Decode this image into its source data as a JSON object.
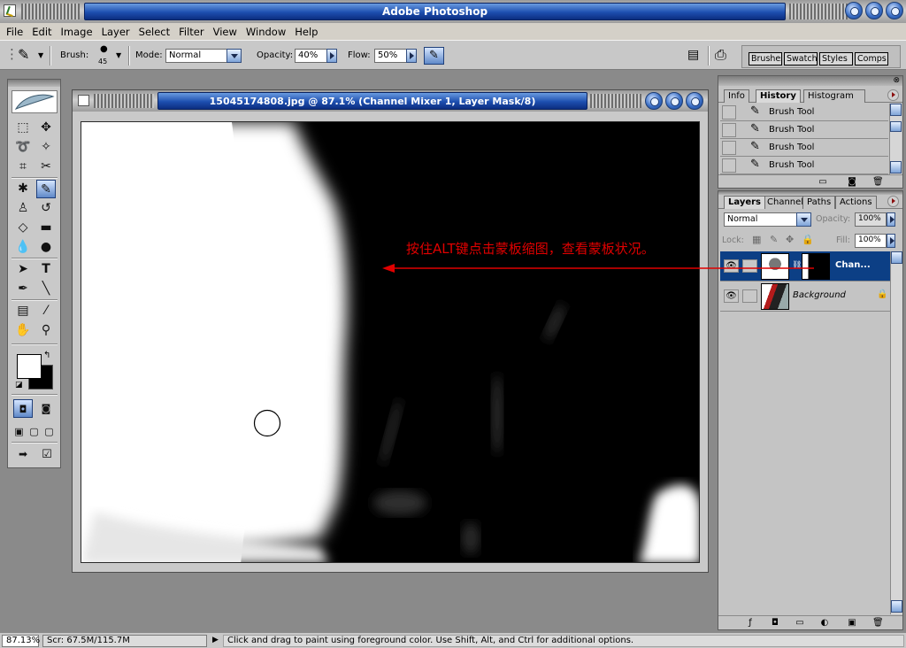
{
  "app": {
    "title": "Adobe Photoshop"
  },
  "menu": [
    "File",
    "Edit",
    "Image",
    "Layer",
    "Select",
    "Filter",
    "View",
    "Window",
    "Help"
  ],
  "options": {
    "brush_label": "Brush:",
    "brush_size": "45",
    "mode_label": "Mode:",
    "mode_value": "Normal",
    "opacity_label": "Opacity:",
    "opacity_value": "40%",
    "flow_label": "Flow:",
    "flow_value": "50%"
  },
  "palette_well": [
    "Brushes",
    "Swatches",
    "Styles",
    "Comps"
  ],
  "document": {
    "title": "15045174808.jpg @ 87.1% (Channel Mixer 1, Layer Mask/8)"
  },
  "history_palette": {
    "tabs": [
      "Info",
      "History",
      "Histogram"
    ],
    "active_tab": "History",
    "items": [
      "Brush Tool",
      "Brush Tool",
      "Brush Tool",
      "Brush Tool"
    ]
  },
  "layers_palette": {
    "tabs": [
      "Layers",
      "Channels",
      "Paths",
      "Actions"
    ],
    "active_tab": "Layers",
    "blend_mode": "Normal",
    "opacity_label": "Opacity:",
    "opacity_value": "100%",
    "lock_label": "Lock:",
    "fill_label": "Fill:",
    "fill_value": "100%",
    "layers": [
      {
        "name": "Chan...",
        "selected": true
      },
      {
        "name": "Background",
        "selected": false,
        "locked": true
      }
    ]
  },
  "annotation": {
    "text": "按住ALT键点击蒙板缩图，查看蒙板状况。",
    "color": "#e00000"
  },
  "status": {
    "zoom": "87.13%",
    "scratch": "Scr: 67.5M/115.7M",
    "hint": "Click and drag to paint using foreground color.  Use Shift, Alt, and Ctrl for additional options."
  },
  "colors": {
    "title_blue": "#1d4fb0",
    "selection_blue": "#0c3f85",
    "annotation_red": "#e00000"
  }
}
